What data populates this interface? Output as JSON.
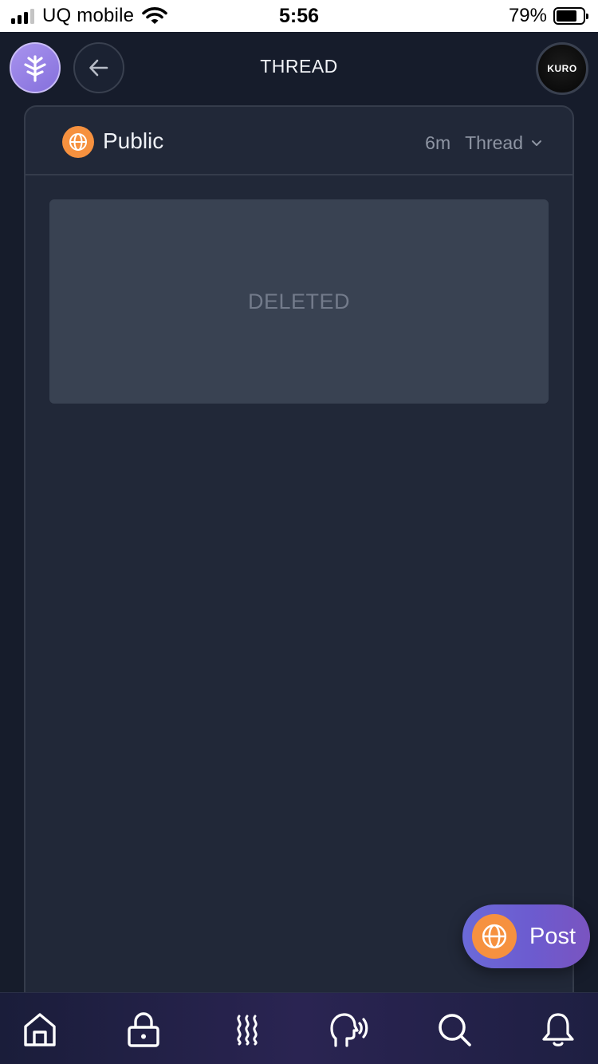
{
  "status_bar": {
    "carrier": "UQ mobile",
    "time": "5:56",
    "battery_percent": "79%",
    "battery_level": 0.79,
    "signal_bars_active": 3,
    "signal_bars_total": 4
  },
  "header": {
    "title": "THREAD",
    "avatar_text": "KURO"
  },
  "card": {
    "visibility": "Public",
    "age": "6m",
    "view_mode": "Thread",
    "deleted_text": "DELETED"
  },
  "fab": {
    "label": "Post"
  },
  "colors": {
    "background": "#161c2b",
    "card": "#212838",
    "deleted_box": "#394252",
    "accent_orange": "#f6913f",
    "accent_purple": "#8570dc"
  },
  "tabbar": {
    "items": [
      {
        "icon": "home-icon"
      },
      {
        "icon": "lock-icon"
      },
      {
        "icon": "heat-waves-icon"
      },
      {
        "icon": "speaking-head-icon"
      },
      {
        "icon": "search-icon"
      },
      {
        "icon": "bell-icon"
      }
    ]
  }
}
